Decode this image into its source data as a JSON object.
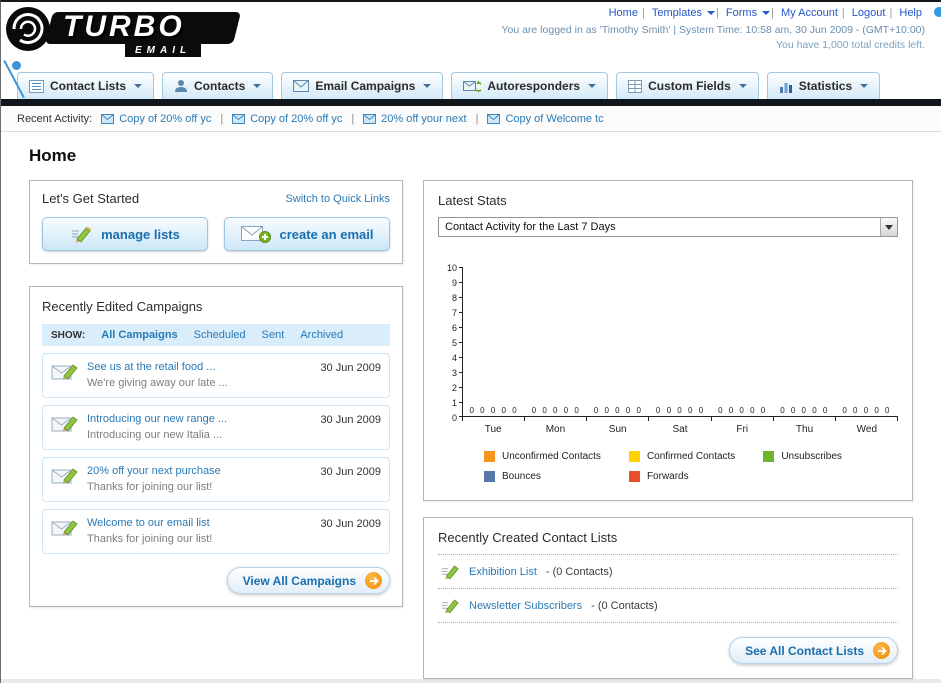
{
  "header": {
    "logo_text": "TURBO",
    "logo_sub": "EMAIL",
    "links": [
      "Home",
      "Templates",
      "Forms",
      "My Account",
      "Logout",
      "Help"
    ],
    "login_info": "You are logged in as 'Timothy Smith' | System Time: 10:58 am, 30 Jun 2009 - (GMT+10:00)",
    "credits_info": "You have 1,000 total credits left."
  },
  "main_nav": {
    "items": [
      {
        "label": "Contact Lists"
      },
      {
        "label": "Contacts"
      },
      {
        "label": "Email Campaigns"
      },
      {
        "label": "Autoresponders"
      },
      {
        "label": "Custom Fields"
      },
      {
        "label": "Statistics"
      }
    ]
  },
  "recent_activity": {
    "label": "Recent Activity:",
    "items": [
      "Copy of 20% off yc",
      "Copy of 20% off yc",
      "20% off your next",
      "Copy of Welcome tc"
    ]
  },
  "page_title": "Home",
  "get_started": {
    "title": "Let's Get Started",
    "switch_link": "Switch to Quick Links",
    "buttons": [
      {
        "label": "manage lists"
      },
      {
        "label": "create an email"
      }
    ]
  },
  "campaigns": {
    "title": "Recently Edited Campaigns",
    "show_label": "SHOW:",
    "tabs": [
      "All Campaigns",
      "Scheduled",
      "Sent",
      "Archived"
    ],
    "items": [
      {
        "title": "See us at the retail food ...",
        "subtitle": "We're giving away our late ...",
        "date": "30 Jun 2009"
      },
      {
        "title": "Introducing our new range ...",
        "subtitle": "Introducing our new Italia ...",
        "date": "30 Jun 2009"
      },
      {
        "title": "20% off your next purchase",
        "subtitle": "Thanks for joining our list!",
        "date": "30 Jun 2009"
      },
      {
        "title": "Welcome to our email list",
        "subtitle": "Thanks for joining our list!",
        "date": "30 Jun 2009"
      }
    ],
    "view_all_label": "View All Campaigns"
  },
  "stats": {
    "title": "Latest Stats",
    "dropdown_value": "Contact Activity for the Last 7 Days",
    "chart_data": {
      "type": "bar",
      "title": "Contact Activity for the Last 7 Days",
      "categories": [
        "Tue",
        "Mon",
        "Sun",
        "Sat",
        "Fri",
        "Thu",
        "Wed"
      ],
      "series": [
        {
          "name": "Unconfirmed Contacts",
          "color": "#f7941d",
          "values": [
            0,
            0,
            0,
            0,
            0,
            0,
            0
          ]
        },
        {
          "name": "Confirmed Contacts",
          "color": "#ffd200",
          "values": [
            0,
            0,
            0,
            0,
            0,
            0,
            0
          ]
        },
        {
          "name": "Unsubscribes",
          "color": "#6cb52d",
          "values": [
            0,
            0,
            0,
            0,
            0,
            0,
            0
          ]
        },
        {
          "name": "Bounces",
          "color": "#5577aa",
          "values": [
            0,
            0,
            0,
            0,
            0,
            0,
            0
          ]
        },
        {
          "name": "Forwards",
          "color": "#e8502d",
          "values": [
            0,
            0,
            0,
            0,
            0,
            0,
            0
          ]
        }
      ],
      "xlabel": "",
      "ylabel": "",
      "ylim": [
        0,
        10
      ],
      "yticks": [
        0,
        1,
        2,
        3,
        4,
        5,
        6,
        7,
        8,
        9,
        10
      ],
      "grid": false,
      "legend_position": "bottom"
    }
  },
  "contact_lists": {
    "title": "Recently Created Contact Lists",
    "items": [
      {
        "name": "Exhibition List",
        "count": "- (0 Contacts)"
      },
      {
        "name": "Newsletter Subscribers",
        "count": "- (0 Contacts)"
      }
    ],
    "see_all_label": "See All Contact Lists"
  },
  "colors": {
    "accent_orange": "#f28a00",
    "link_blue": "#2a7ab5",
    "nav_dark_bar": "#11161d"
  }
}
